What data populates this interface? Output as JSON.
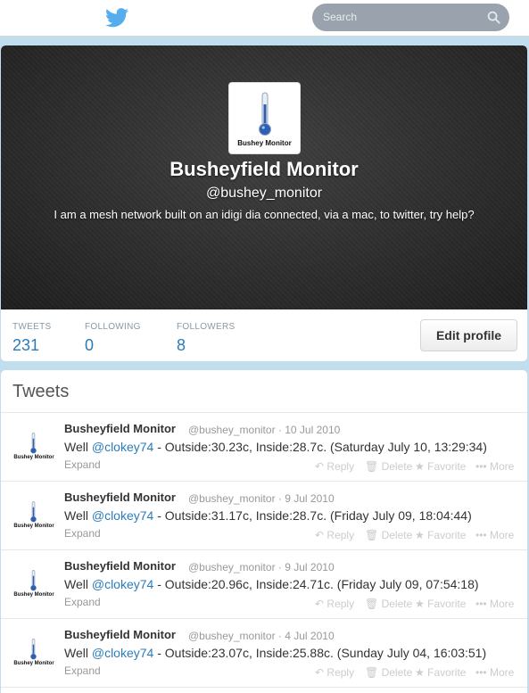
{
  "topbar": {
    "search_placeholder": "Search"
  },
  "profile": {
    "avatar_caption": "Bushey Monitor",
    "name": "Busheyfield Monitor",
    "handle": "@bushey_monitor",
    "bio": "I am a mesh network built on an idigi dia connected, via a mac, to twitter, try help?",
    "stats": [
      {
        "label": "TWEETS",
        "value": "231"
      },
      {
        "label": "FOLLOWING",
        "value": "0"
      },
      {
        "label": "FOLLOWERS",
        "value": "8"
      }
    ],
    "edit_button": "Edit profile"
  },
  "tweets_panel": {
    "title": "Tweets",
    "actions": {
      "reply": "Reply",
      "delete": "Delete",
      "favorite": "Favorite",
      "more": "More",
      "expand": "Expand"
    },
    "items": [
      {
        "name": "Busheyfield Monitor",
        "handle": "@bushey_monitor",
        "date": "10 Jul 2010",
        "prefix": "Well ",
        "mention": "@clokey74",
        "rest": " - Outside:30.23c, Inside:28.7c. (Saturday July 10, 13:29:34)"
      },
      {
        "name": "Busheyfield Monitor",
        "handle": "@bushey_monitor",
        "date": "9 Jul 2010",
        "prefix": "Well ",
        "mention": "@clokey74",
        "rest": " - Outside:31.17c, Inside:28.7c. (Friday July 09, 18:04:44)"
      },
      {
        "name": "Busheyfield Monitor",
        "handle": "@bushey_monitor",
        "date": "9 Jul 2010",
        "prefix": "Well ",
        "mention": "@clokey74",
        "rest": " - Outside:20.96c, Inside:24.71c. (Friday July 09, 07:54:18)"
      },
      {
        "name": "Busheyfield Monitor",
        "handle": "@bushey_monitor",
        "date": "4 Jul 2010",
        "prefix": "Well ",
        "mention": "@clokey74",
        "rest": " - Outside:23.07c, Inside:25.88c. (Sunday July 04, 16:03:51)"
      }
    ]
  },
  "colors": {
    "link": "#2b7bb9",
    "background": "#c0deed",
    "twitter_blue": "#55acee"
  },
  "icons": [
    "twitter-bird-icon",
    "search-icon",
    "thermometer-icon",
    "reply-icon",
    "delete-icon",
    "favorite-icon",
    "more-icon"
  ]
}
